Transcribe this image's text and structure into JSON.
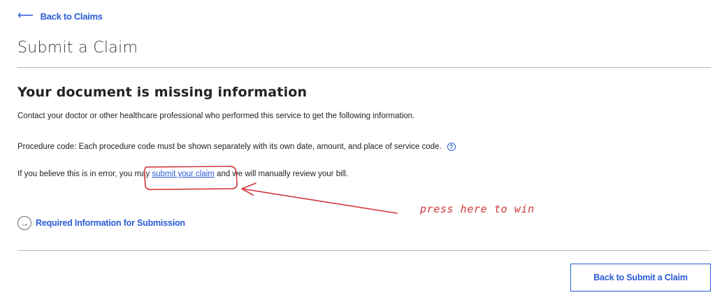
{
  "nav": {
    "back_label": "Back to Claims",
    "back_icon": "arrow-left-icon"
  },
  "page": {
    "title": "Submit a Claim"
  },
  "content": {
    "heading": "Your document is missing information",
    "intro": "Contact your doctor or other healthcare professional who performed this service to get the following information.",
    "procedure_text": "Procedure code: Each procedure code must be shown separately with its own date, amount, and place of service code.",
    "help_icon": "question-circle-icon",
    "error_prefix": "If you believe this is in error, you may ",
    "error_link": "submit your claim",
    "error_suffix": " and we will manually review your bill.",
    "required_info_label": "Required Information for Submission",
    "required_info_icon": "arrow-right-circle-icon"
  },
  "footer": {
    "back_submit_label": "Back to Submit a Claim"
  },
  "annotation": {
    "text": "press here to win",
    "color": "#d1373a"
  },
  "colors": {
    "link": "#2a5bd7",
    "divider": "#b8b8b8",
    "text": "#222222"
  }
}
